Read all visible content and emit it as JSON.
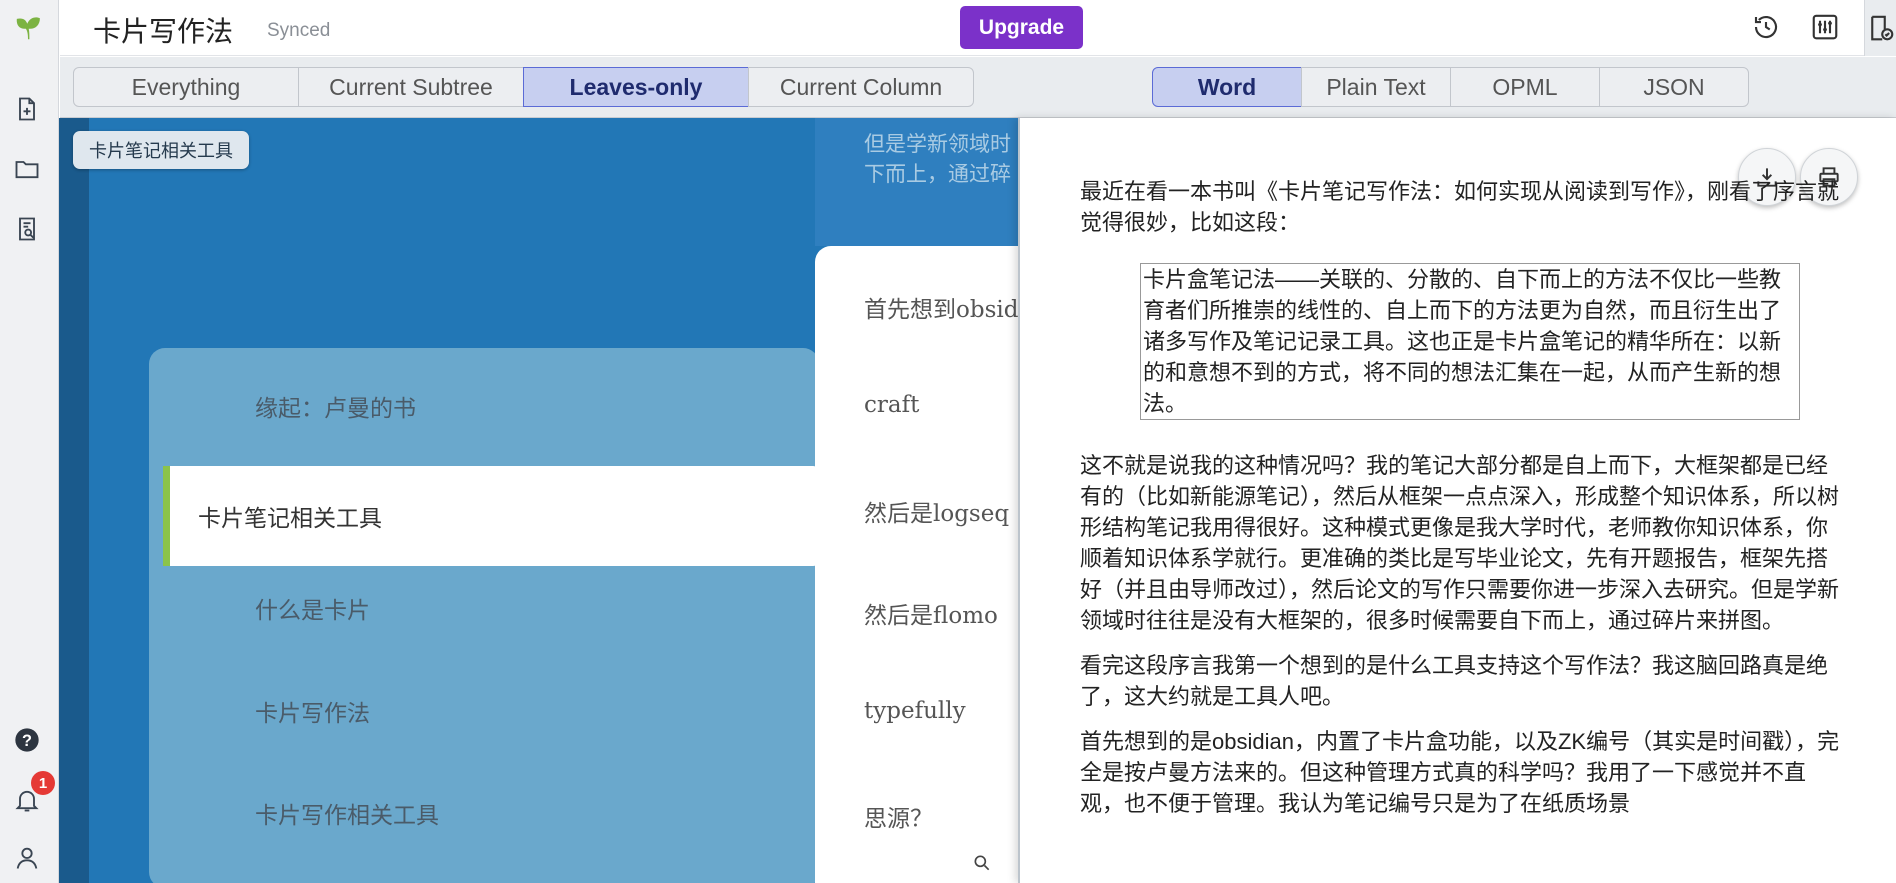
{
  "app": {
    "doc_title": "卡片写作法",
    "sync_status": "Synced",
    "upgrade_label": "Upgrade",
    "notification_count": "1"
  },
  "filters": {
    "scope": [
      "Everything",
      "Current Subtree",
      "Leaves-only",
      "Current Column"
    ],
    "scope_active": "Leaves-only",
    "format": [
      "Word",
      "Plain Text",
      "OPML",
      "JSON"
    ],
    "format_active": "Word"
  },
  "tree": {
    "breadcrumb": "卡片笔记相关工具",
    "column3_header_lines": [
      "但是学新领域时",
      "下而上，通过碎"
    ],
    "column2_cards": [
      "缘起：卢曼的书",
      "卡片笔记相关工具",
      "什么是卡片",
      "卡片写作法",
      "卡片写作相关工具"
    ],
    "column2_active": "卡片笔记相关工具",
    "column3_cards": [
      "首先想到obsid",
      "craft",
      "然后是logseq",
      "然后是flomo",
      "typefully",
      "思源？"
    ]
  },
  "export": {
    "intro": "最近在看一本书叫《卡片笔记写作法：如何实现从阅读到写作》，刚看了序言就觉得很妙，比如这段：",
    "quote": "卡片盒笔记法——关联的、分散的、自下而上的方法不仅比一些教育者们所推崇的线性的、自上而下的方法更为自然，而且衍生出了诸多写作及笔记记录工具。这也正是卡片盒笔记的精华所在：以新的和意想不到的方式，将不同的想法汇集在一起，从而产生新的想法。",
    "paragraphs": [
      "这不就是说我的这种情况吗？我的笔记大部分都是自上而下，大框架都是已经有的（比如新能源笔记），然后从框架一点点深入，形成整个知识体系，所以树形结构笔记我用得很好。这种模式更像是我大学时代，老师教你知识体系，你顺着知识体系学就行。更准确的类比是写毕业论文，先有开题报告，框架先搭好（并且由导师改过），然后论文的写作只需要你进一步深入去研究。但是学新领域时往往是没有大框架的，很多时候需要自下而上，通过碎片来拼图。",
      "看完这段序言我第一个想到的是什么工具支持这个写作法？我这脑回路真是绝了，这大约就是工具人吧。",
      "首先想到的是obsidian，内置了卡片盒功能，以及ZK编号（其实是时间戳），完全是按卢曼方法来的。但这种管理方式真的科学吗？我用了一下感觉并不直观，也不便于管理。我认为笔记编号只是为了在纸质场景"
    ]
  }
}
